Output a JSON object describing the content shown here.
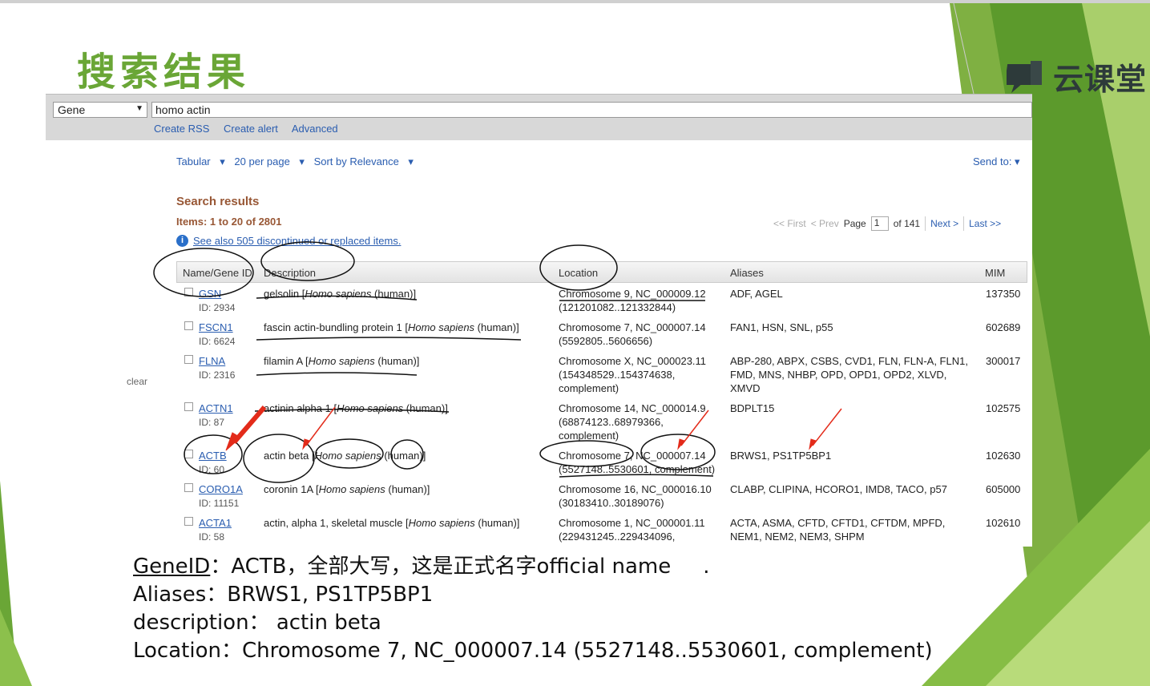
{
  "slide": {
    "title": "搜索结果",
    "logo_text": "云课堂",
    "colors": {
      "accent_green": "#6aa636",
      "link_blue": "#2a5db0",
      "results_brown": "#985735",
      "annotation_red": "#e32b1a"
    }
  },
  "search": {
    "database": "Gene",
    "query": "homo actin",
    "links": [
      "Create RSS",
      "Create alert",
      "Advanced"
    ]
  },
  "toolbar": {
    "format": "Tabular",
    "per_page": "20 per page",
    "sort": "Sort by Relevance",
    "send_to": "Send to:"
  },
  "results": {
    "title": "Search results",
    "items": "Items: 1 to 20 of 2801",
    "see_also": "See also 505 discontinued or replaced items."
  },
  "pager": {
    "first": "<< First",
    "prev": "< Prev",
    "page_label": "Page",
    "page_value": "1",
    "of_total": "of 141",
    "next": "Next >",
    "last": "Last >>"
  },
  "sidebar": {
    "clear": "clear"
  },
  "table": {
    "headers": [
      "Name/Gene ID",
      "Description",
      "Location",
      "Aliases",
      "MIM"
    ],
    "rows": [
      {
        "name": "GSN",
        "id": "ID: 2934",
        "desc_pre": "gelsolin [",
        "desc_species": "Homo sapiens",
        "desc_post": " (human)]",
        "loc1": "Chromosome 9, NC_000009.12",
        "loc2": "(121201082..121332844)",
        "loc3": "",
        "alias1": "ADF, AGEL",
        "alias2": "",
        "alias3": "",
        "mim": "137350"
      },
      {
        "name": "FSCN1",
        "id": "ID: 6624",
        "desc_pre": "fascin actin-bundling protein 1 [",
        "desc_species": "Homo sapiens",
        "desc_post": " (human)]",
        "loc1": "Chromosome 7, NC_000007.14",
        "loc2": "(5592805..5606656)",
        "loc3": "",
        "alias1": "FAN1, HSN, SNL, p55",
        "alias2": "",
        "alias3": "",
        "mim": "602689"
      },
      {
        "name": "FLNA",
        "id": "ID: 2316",
        "desc_pre": "filamin A [",
        "desc_species": "Homo sapiens",
        "desc_post": " (human)]",
        "loc1": "Chromosome X, NC_000023.11",
        "loc2": "(154348529..154374638,",
        "loc3": "complement)",
        "alias1": "ABP-280, ABPX, CSBS, CVD1, FLN, FLN-A, FLN1,",
        "alias2": "FMD, MNS, NHBP, OPD, OPD1, OPD2, XLVD,",
        "alias3": "XMVD",
        "mim": "300017"
      },
      {
        "name": "ACTN1",
        "id": "ID: 87",
        "desc_pre": "actinin alpha 1 [",
        "desc_species": "Homo sapiens",
        "desc_post": " (human)]",
        "loc1": "Chromosome 14, NC_000014.9",
        "loc2": "(68874123..68979366,",
        "loc3": "complement)",
        "alias1": "BDPLT15",
        "alias2": "",
        "alias3": "",
        "mim": "102575"
      },
      {
        "name": "ACTB",
        "id": "ID: 60",
        "desc_pre": "actin beta [",
        "desc_species": "Homo sapiens",
        "desc_post": " (human)]",
        "loc1": "Chromosome 7, NC_000007.14",
        "loc2": "(5527148..5530601, complement)",
        "loc3": "",
        "alias1": "BRWS1, PS1TP5BP1",
        "alias2": "",
        "alias3": "",
        "mim": "102630"
      },
      {
        "name": "CORO1A",
        "id": "ID: 11151",
        "desc_pre": "coronin 1A [",
        "desc_species": "Homo sapiens",
        "desc_post": " (human)]",
        "loc1": "Chromosome 16, NC_000016.10",
        "loc2": "(30183410..30189076)",
        "loc3": "",
        "alias1": "CLABP, CLIPINA, HCORO1, IMD8, TACO, p57",
        "alias2": "",
        "alias3": "",
        "mim": "605000"
      },
      {
        "name": "ACTA1",
        "id": "ID: 58",
        "desc_pre": "actin, alpha 1, skeletal muscle [",
        "desc_species": "Homo sapiens",
        "desc_post": " (human)]",
        "loc1": "Chromosome 1, NC_000001.11",
        "loc2": "(229431245..229434096,",
        "loc3": "",
        "alias1": "ACTA, ASMA, CFTD, CFTD1, CFTDM, MPFD,",
        "alias2": "NEM1, NEM2, NEM3, SHPM",
        "alias3": "",
        "mim": "102610"
      }
    ]
  },
  "notes": {
    "line1_label": "GeneID",
    "line1_text": "：ACTB，全部大写，这是正式名字official name",
    "line1_dot": ".",
    "line2": "Aliases：BRWS1, PS1TP5BP1",
    "line3": "description：  actin beta",
    "line4": "Location：Chromosome 7, NC_000007.14 (5527148..5530601, complement)"
  }
}
